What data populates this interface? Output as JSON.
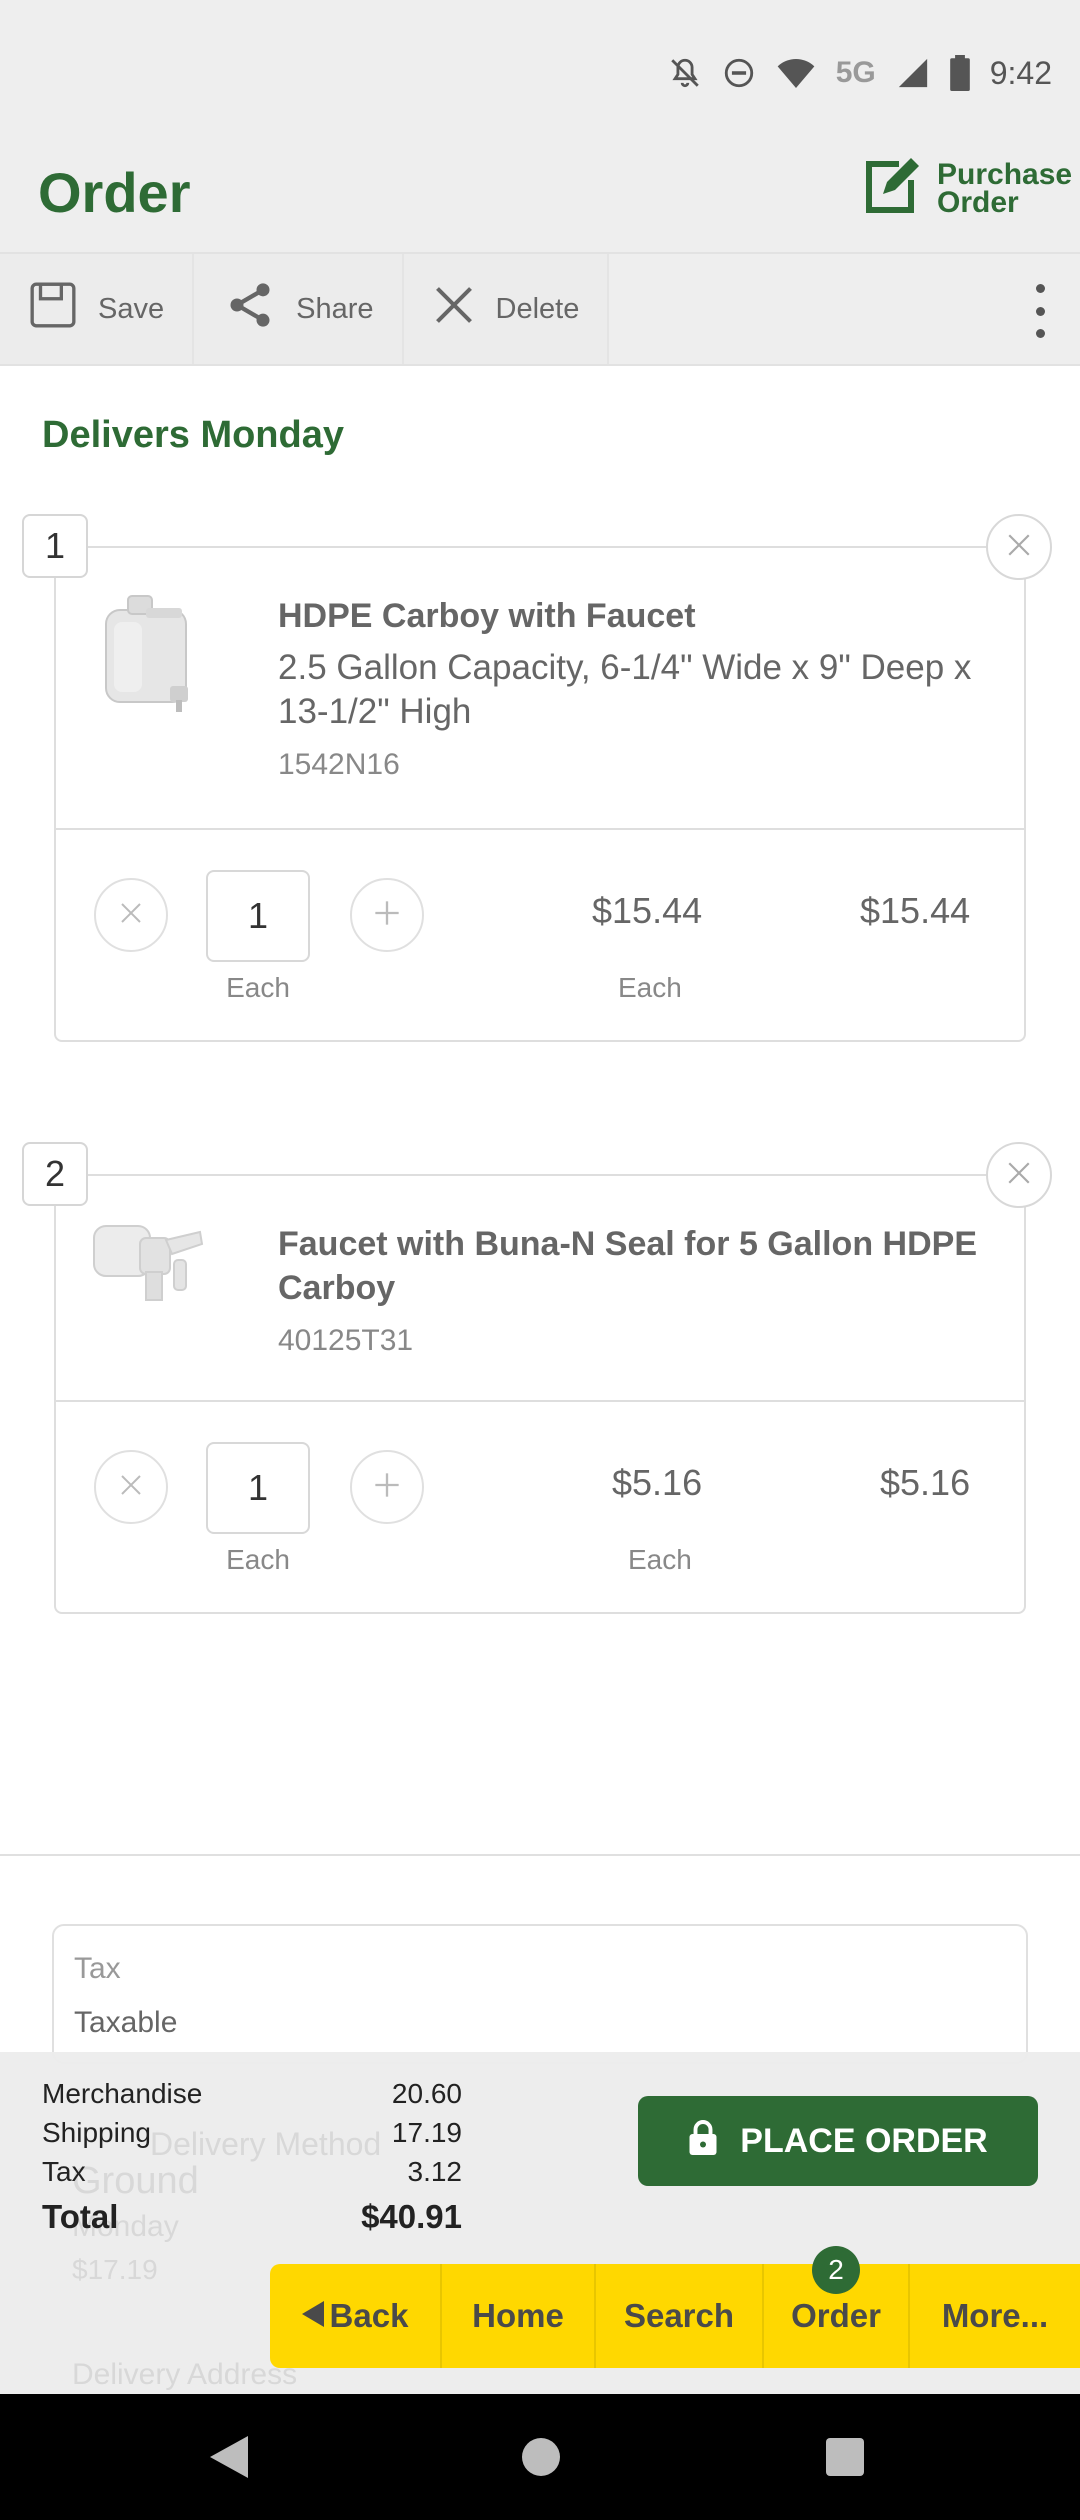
{
  "status_bar": {
    "network": "5G",
    "time": "9:42"
  },
  "header": {
    "title": "Order",
    "purchase_order_label": "Purchase Order"
  },
  "toolbar": {
    "save": "Save",
    "share": "Share",
    "delete": "Delete"
  },
  "delivery": {
    "heading": "Delivers Monday"
  },
  "items": [
    {
      "index": "1",
      "name": "HDPE Carboy with Faucet",
      "description": "2.5 Gallon Capacity, 6-1/4\" Wide x 9\" Deep x 13-1/2\" High",
      "sku": "1542N16",
      "quantity": "1",
      "unit": "Each",
      "unit_price": "$15.44",
      "price_unit": "Each",
      "line_total": "$15.44"
    },
    {
      "index": "2",
      "name": "Faucet with Buna-N Seal for 5 Gallon HDPE Carboy",
      "sku": "40125T31",
      "quantity": "1",
      "unit": "Each",
      "unit_price": "$5.16",
      "price_unit": "Each",
      "line_total": "$5.16"
    }
  ],
  "tax_section": {
    "title": "Tax",
    "value": "Taxable"
  },
  "background": {
    "delivery_method_label": "Delivery Method",
    "method": "Ground",
    "day": "Monday",
    "cost": "$17.19",
    "address_label": "Delivery Address"
  },
  "summary": {
    "merchandise_label": "Merchandise",
    "merchandise": "20.60",
    "shipping_label": "Shipping",
    "shipping": "17.19",
    "tax_label": "Tax",
    "tax": "3.12",
    "total_label": "Total",
    "total": "$40.91"
  },
  "place_order_label": "PLACE ORDER",
  "nav": {
    "back": "Back",
    "home": "Home",
    "search": "Search",
    "order": "Order",
    "order_badge": "2",
    "more": "More..."
  },
  "colors": {
    "brand_green": "#2e6b35",
    "nav_yellow": "#ffd800"
  }
}
